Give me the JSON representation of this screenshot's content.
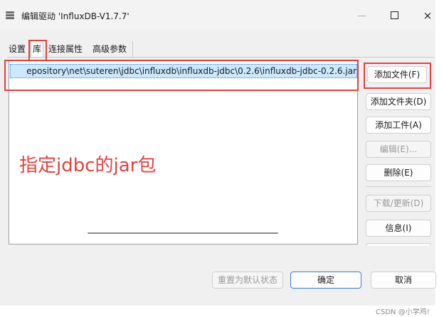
{
  "window": {
    "title": "编辑驱动 'InfluxDB-V1.7.7'",
    "minimize_icon": "minimize-icon",
    "maximize_icon": "maximize-icon",
    "close_glyph": "×"
  },
  "tabs": [
    {
      "label": "设置",
      "selected": false
    },
    {
      "label": "库",
      "selected": true
    },
    {
      "label": "连接属性",
      "selected": false
    },
    {
      "label": "高级参数",
      "selected": false
    }
  ],
  "library": {
    "items": [
      "epository\\net\\suteren\\jdbc\\influxdb\\influxdb-jdbc\\0.2.6\\influxdb-jdbc-0.2.6.jar"
    ]
  },
  "side_buttons": {
    "add_file": "添加文件(F)",
    "add_folder": "添加文件夹(D)",
    "add_artifact": "添加工件(A)",
    "edit": "编辑(E)...",
    "delete": "删除(E)",
    "download_update": "下载/更新(D)",
    "info": "信息(I)"
  },
  "footer": {
    "reset": "重置为默认状态",
    "ok": "确定",
    "cancel": "取消"
  },
  "annotation": {
    "text": "指定jdbc的jar包",
    "color": "#e0443e"
  },
  "watermark": "CSDN @小学鸡!"
}
